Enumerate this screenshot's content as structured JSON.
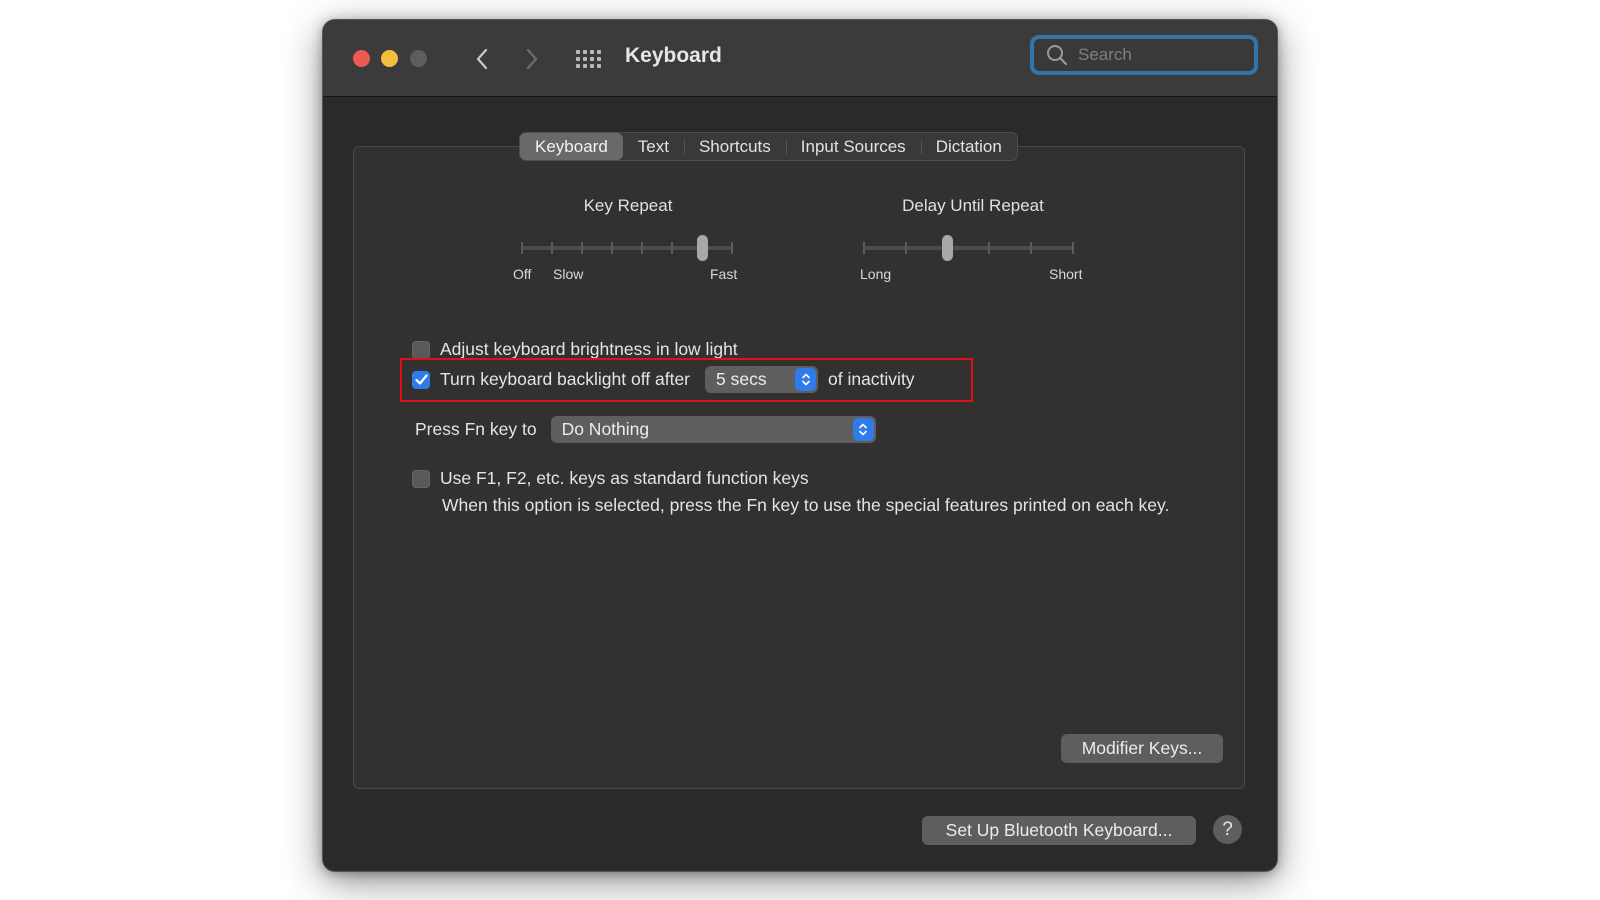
{
  "window": {
    "title": "Keyboard",
    "traffic_lights": {
      "close": "#ed5a55",
      "minimize": "#f5bd3c",
      "zoom": "#5e5d5d"
    },
    "nav": {
      "back_icon": "chevron-left",
      "forward_icon": "chevron-right",
      "show_all_icon": "grid"
    },
    "search": {
      "placeholder": "Search",
      "value": "",
      "focus_color": "#2f76ad"
    }
  },
  "tabs": [
    {
      "label": "Keyboard",
      "active": true
    },
    {
      "label": "Text",
      "active": false
    },
    {
      "label": "Shortcuts",
      "active": false
    },
    {
      "label": "Input Sources",
      "active": false
    },
    {
      "label": "Dictation",
      "active": false
    }
  ],
  "sliders": {
    "key_repeat": {
      "title": "Key Repeat",
      "ticks": 8,
      "value_index": 6,
      "labels": {
        "off": "Off",
        "slow": "Slow",
        "fast": "Fast"
      }
    },
    "delay_until_repeat": {
      "title": "Delay Until Repeat",
      "ticks": 6,
      "value_index": 2,
      "labels": {
        "long": "Long",
        "short": "Short"
      }
    }
  },
  "options": {
    "adjust_brightness": {
      "label": "Adjust keyboard brightness in low light",
      "checked": false
    },
    "backlight_off": {
      "label": "Turn keyboard backlight off after",
      "checked": true,
      "duration": "5 secs",
      "suffix": "of inactivity",
      "highlight_color": "#e0101a"
    },
    "fn_key": {
      "label": "Press Fn key to",
      "value": "Do Nothing"
    },
    "standard_function_keys": {
      "label": "Use F1, F2, etc. keys as standard function keys",
      "checked": false,
      "description": "When this option is selected, press the Fn key to use the special features printed on each key."
    }
  },
  "buttons": {
    "modifier_keys": "Modifier Keys...",
    "bluetooth_keyboard": "Set Up Bluetooth Keyboard...",
    "help": "?"
  },
  "accent_color": "#2f7be8"
}
